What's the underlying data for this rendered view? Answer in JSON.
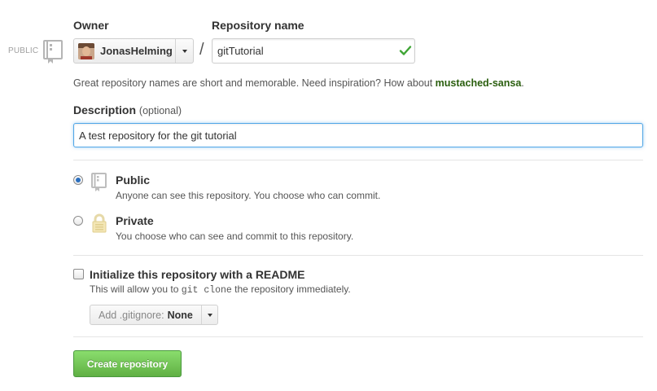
{
  "badge": {
    "public_label": "PUBLIC"
  },
  "owner": {
    "label": "Owner",
    "selected": "JonasHelming"
  },
  "repository": {
    "label": "Repository name",
    "value": "gitTutorial",
    "separator": "/",
    "hint_prefix": "Great repository names are short and memorable. Need inspiration? How about ",
    "suggestion": "mustached-sansa",
    "hint_suffix": "."
  },
  "description": {
    "label": "Description",
    "optional": "(optional)",
    "value": "A test repository for the git tutorial"
  },
  "visibility": {
    "selected": "public",
    "public": {
      "title": "Public",
      "desc": "Anyone can see this repository. You choose who can commit."
    },
    "private": {
      "title": "Private",
      "desc": "You choose who can see and commit to this repository."
    }
  },
  "readme": {
    "checked": false,
    "title": "Initialize this repository with a README",
    "desc_before": "This will allow you to ",
    "desc_code": "git clone",
    "desc_after": " the repository immediately."
  },
  "gitignore": {
    "prefix": "Add .gitignore:",
    "value": "None"
  },
  "actions": {
    "create_label": "Create repository"
  },
  "colors": {
    "accent_green": "#60b044",
    "focus_blue": "#51a7e8",
    "suggestion_green": "#2a5e0e",
    "check_green": "#3fa535"
  }
}
